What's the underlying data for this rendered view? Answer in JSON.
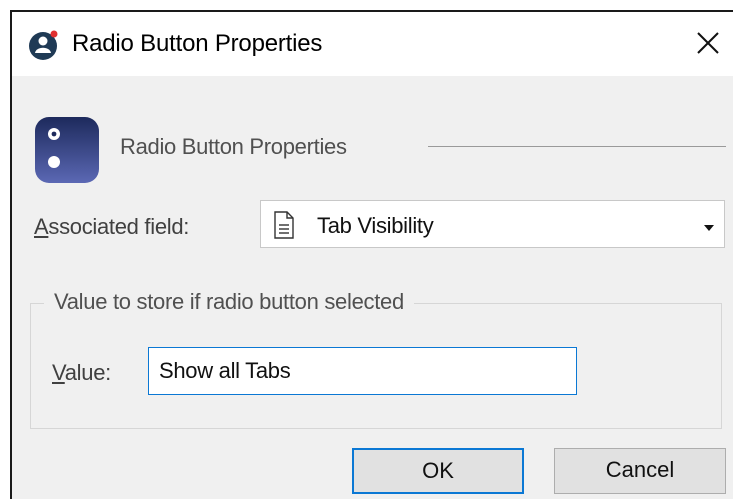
{
  "window": {
    "title": "Radio Button Properties",
    "app_icon": "user-badge-icon",
    "close_glyph": "✕"
  },
  "header": {
    "text": "Radio Button Properties",
    "icon": "radio-button-properties-icon"
  },
  "associated_field": {
    "label_prefix": "A",
    "label_rest": "ssociated field:",
    "selected_value": "Tab Visibility",
    "value_icon": "document-icon",
    "dropdown_icon": "dropdown-arrow-icon"
  },
  "group": {
    "legend": "Value to store if radio button selected",
    "value_label_prefix": "V",
    "value_label_rest": "alue:",
    "value": "Show all Tabs"
  },
  "buttons": {
    "ok": "OK",
    "cancel": "Cancel"
  },
  "colors": {
    "accent": "#0b78d4",
    "dialog_bg": "#f0f0f0",
    "button_bg": "#e1e1e1"
  }
}
